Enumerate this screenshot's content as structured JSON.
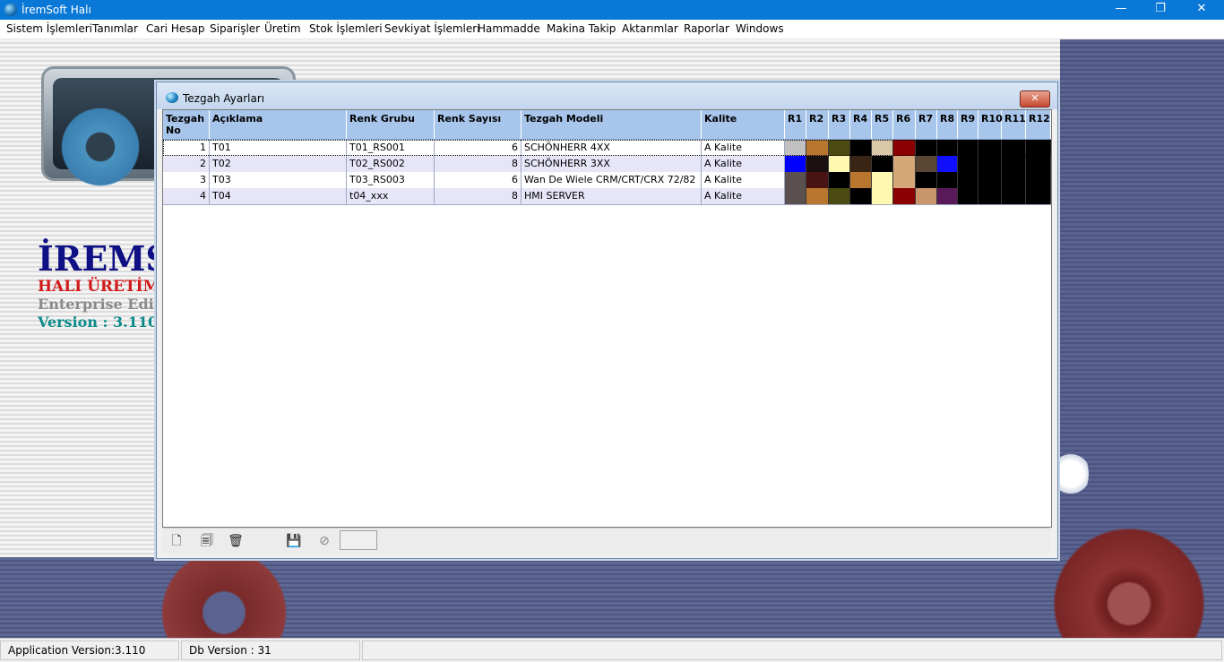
{
  "app": {
    "title": "İremSoft Halı"
  },
  "window_controls": {
    "minimize": "—",
    "maximize": "❐",
    "close": "✕"
  },
  "menu": [
    "Sistem İşlemleri",
    "Tanımlar",
    "Cari Hesap",
    "Siparişler",
    "Üretim",
    "Stok İşlemleri",
    "Sevkiyat İşlemleri",
    "Hammadde",
    "Makina Takip",
    "Aktarımlar",
    "Raporlar",
    "Windows"
  ],
  "background": {
    "brand_title": "İREMS",
    "brand_line1": "HALI ÜRETİM",
    "brand_line2": "Enterprise Editi",
    "brand_version": "Version : 3.110"
  },
  "child_window": {
    "title": "Tezgah Ayarları",
    "close_glyph": "✕",
    "columns": [
      "Tezgah No",
      "Açıklama",
      "Renk Grubu",
      "Renk Sayısı",
      "Tezgah Modeli",
      "Kalite",
      "R1",
      "R2",
      "R3",
      "R4",
      "R5",
      "R6",
      "R7",
      "R8",
      "R9",
      "R10",
      "R11",
      "R12"
    ],
    "rows": [
      {
        "no": "1",
        "aciklama": "T01",
        "renk_grubu": "T01_RS001",
        "renk_sayisi": "6",
        "model": "SCHÖNHERR 4XX",
        "kalite": "A Kalite",
        "colors": [
          "#c0c0c0",
          "#b8762f",
          "#4b4a10",
          "#000000",
          "#d8c8a8",
          "#8b0000",
          "#000000",
          "#000000",
          "#000000",
          "#000000",
          "#000000",
          "#000000"
        ]
      },
      {
        "no": "2",
        "aciklama": "T02",
        "renk_grubu": "T02_RS002",
        "renk_sayisi": "8",
        "model": "SCHÖNHERR 3XX",
        "kalite": "A Kalite",
        "colors": [
          "#0000ff",
          "#1a1010",
          "#fff8b0",
          "#3a2414",
          "#000000",
          "#d4a878",
          "#5a4632",
          "#1010ff",
          "#000000",
          "#000000",
          "#000000",
          "#000000"
        ]
      },
      {
        "no": "3",
        "aciklama": "T03",
        "renk_grubu": "T03_RS003",
        "renk_sayisi": "6",
        "model": "Wan De Wiele CRM/CRT/CRX 72/82",
        "kalite": "A Kalite",
        "colors": [
          "#5a5050",
          "#4a1414",
          "#000000",
          "#b8762f",
          "#fff8b0",
          "#d4a878",
          "#000000",
          "#000000",
          "#000000",
          "#000000",
          "#000000",
          "#000000"
        ]
      },
      {
        "no": "4",
        "aciklama": "T04",
        "renk_grubu": "t04_xxx",
        "renk_sayisi": "8",
        "model": "HMI SERVER",
        "kalite": "A Kalite",
        "colors": [
          "#5a5050",
          "#b8762f",
          "#4b4a10",
          "#000000",
          "#fff8b0",
          "#8b0000",
          "#c8966a",
          "#5a1a5a",
          "#000000",
          "#000000",
          "#000000",
          "#000000"
        ]
      }
    ],
    "toolbar": [
      {
        "name": "new-record-icon",
        "glyph": "🗋",
        "enabled": true
      },
      {
        "name": "edit-record-icon",
        "glyph": "🗐",
        "enabled": true
      },
      {
        "name": "delete-record-icon",
        "glyph": "🗑",
        "enabled": true
      },
      {
        "name": "save-icon",
        "glyph": "💾",
        "enabled": false
      },
      {
        "name": "cancel-icon",
        "glyph": "⊘",
        "enabled": false
      }
    ]
  },
  "statusbar": {
    "app_version": "Application Version:3.110",
    "db_version": "Db Version : 31"
  }
}
